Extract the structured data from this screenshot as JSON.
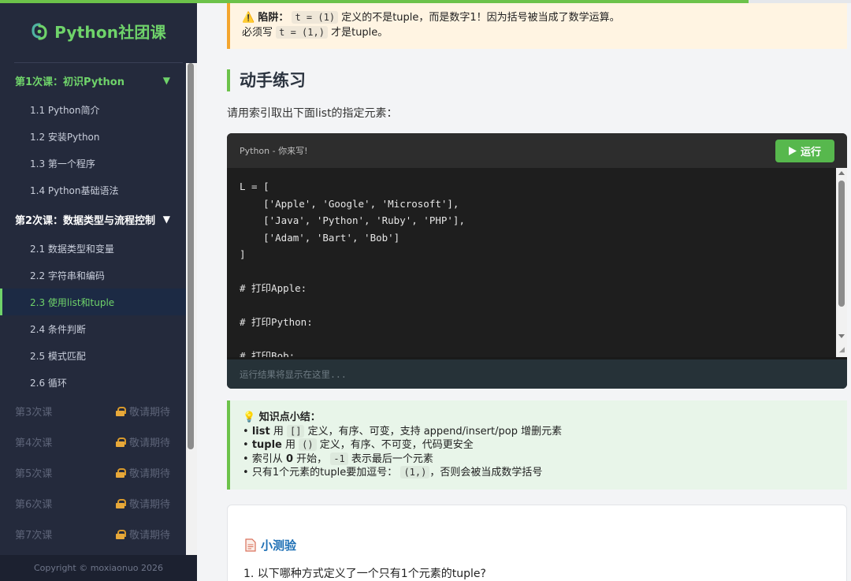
{
  "progress": {
    "fraction": 0.88
  },
  "sidebar": {
    "brand": "Python社团课",
    "lesson1": {
      "label": "第1次课：初识Python",
      "caret": "▼"
    },
    "lesson1_items": [
      "1.1 Python简介",
      "1.2 安装Python",
      "1.3 第一个程序",
      "1.4 Python基础语法"
    ],
    "lesson2": {
      "label": "第2次课：数据类型与流程控制",
      "caret": "▼"
    },
    "lesson2_items": [
      "2.1 数据类型和变量",
      "2.2 字符串和编码",
      "2.3 使用list和tuple",
      "2.4 条件判断",
      "2.5 模式匹配",
      "2.6 循环"
    ],
    "locked": [
      {
        "label": "第3次课",
        "status": "敬请期待"
      },
      {
        "label": "第4次课",
        "status": "敬请期待"
      },
      {
        "label": "第5次课",
        "status": "敬请期待"
      },
      {
        "label": "第6次课",
        "status": "敬请期待"
      },
      {
        "label": "第7次课",
        "status": "敬请期待"
      }
    ],
    "footer": "Copyright © moxiaonuo 2026"
  },
  "warning": {
    "icon": "⚠️",
    "label": "陷阱：",
    "code1": "t = (1)",
    "text1": "定义的不是tuple，而是数字1！因为括号被当成了数学运算。",
    "text2": "必须写",
    "code2": "t = (1,)",
    "text3": "才是tuple。"
  },
  "section": {
    "heading": "动手练习",
    "intro": "请用索引取出下面list的指定元素："
  },
  "editor": {
    "title": "Python - 你来写!",
    "run_label": "运行",
    "code": "L = [\n    ['Apple', 'Google', 'Microsoft'],\n    ['Java', 'Python', 'Ruby', 'PHP'],\n    ['Adam', 'Bart', 'Bob']\n]\n\n# 打印Apple:\n\n# 打印Python:\n\n# 打印Bob:",
    "output_placeholder": "运行结果将显示在这里..."
  },
  "tips": {
    "icon": "💡",
    "title": "知识点小结：",
    "line1": {
      "bold": "list",
      "pre": "用",
      "code": "[]",
      "post": "定义，有序、可变，支持 append/insert/pop 增删元素"
    },
    "line2": {
      "bold": "tuple",
      "pre": "用",
      "code": "()",
      "post": "定义，有序、不可变，代码更安全"
    },
    "line3": {
      "pre": "索引从",
      "bold": "0",
      "mid": "开始，",
      "code": "-1",
      "post": "表示最后一个元素"
    },
    "line4": {
      "pre": "只有1个元素的tuple要加逗号：",
      "code": "(1,)",
      "post": "，否则会被当成数学括号"
    }
  },
  "quiz": {
    "title": "小测验",
    "question": "1. 以下哪种方式定义了一个只有1个元素的tuple?"
  },
  "colors": {
    "accent_green": "#6cc24a",
    "sidebar_bg": "#242a3c",
    "warning_border": "#f3a52e",
    "quiz_blue": "#1d6fb5"
  }
}
